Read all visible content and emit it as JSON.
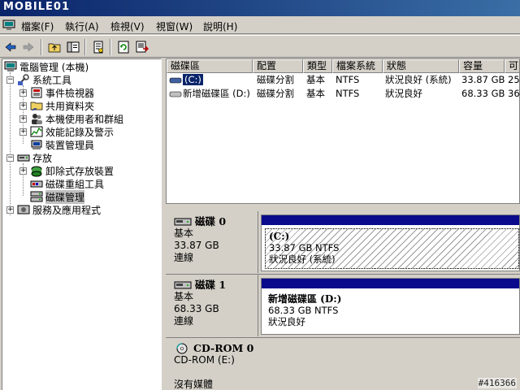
{
  "title_bar": {
    "logo_text": "MOBILE01"
  },
  "menu": {
    "items": [
      "檔案(F)",
      "執行(A)",
      "檢視(V)",
      "視窗(W)",
      "說明(H)"
    ]
  },
  "tree": {
    "root": "電腦管理 (本機)",
    "system_tools": "系統工具",
    "event_viewer": "事件檢視器",
    "shared_folders": "共用資料夾",
    "local_users": "本機使用者和群組",
    "perf_logs": "效能記錄及警示",
    "device_manager": "裝置管理員",
    "storage": "存放",
    "removable_storage": "卸除式存放裝置",
    "defrag": "磁碟重組工具",
    "disk_management": "磁碟管理",
    "services_apps": "服務及應用程式"
  },
  "volume_list": {
    "columns": [
      "磁碟區",
      "配置",
      "類型",
      "檔案系統",
      "狀態",
      "容量",
      "可"
    ],
    "rows": [
      {
        "volume": "(C:)",
        "layout": "磁碟分割",
        "type": "基本",
        "fs": "NTFS",
        "status": "狀況良好 (系統)",
        "capacity": "33.87 GB",
        "free": "25."
      },
      {
        "volume": "新增磁碟區 (D:)",
        "layout": "磁碟分割",
        "type": "基本",
        "fs": "NTFS",
        "status": "狀況良好",
        "capacity": "68.33 GB",
        "free": "36."
      }
    ]
  },
  "disks": [
    {
      "name": "磁碟 0",
      "type": "基本",
      "size": "33.87 GB",
      "state": "連線",
      "partition": {
        "name": "(C:)",
        "detail": "33.87 GB NTFS",
        "status": "狀況良好 (系統)"
      }
    },
    {
      "name": "磁碟 1",
      "type": "基本",
      "size": "68.33 GB",
      "state": "連線",
      "partition": {
        "name": "新增磁碟區  (D:)",
        "detail": "68.33 GB NTFS",
        "status": "狀況良好"
      }
    },
    {
      "name": "CD-ROM 0",
      "type": "CD-ROM (E:)",
      "size": "",
      "state": "沒有媒體"
    }
  ],
  "watermark": "#416366",
  "colors": {
    "selection": "#0a246a",
    "partition_bar": "#0a0a8c",
    "face": "#d4d0c8"
  }
}
